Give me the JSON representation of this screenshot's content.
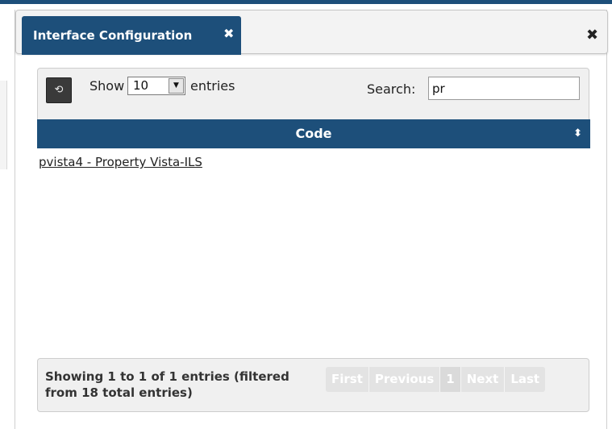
{
  "dialog": {
    "tab_title": "Interface Configuration",
    "tab_close_icon": "close-icon",
    "close_icon": "close-icon"
  },
  "table": {
    "refresh_icon": "refresh-icon",
    "show_label": "Show",
    "page_size": "10",
    "entries_label": "entries",
    "search_label": "Search:",
    "search_value": "pr",
    "columns": [
      {
        "label": "Code",
        "sort_icon": "sort-icon"
      }
    ],
    "rows": [
      {
        "code": "pvista4 - Property Vista-ILS"
      }
    ]
  },
  "footer": {
    "info_line1": "Showing 1 to 1 of 1 entries (filtered",
    "info_line2": "from 18 total entries)",
    "pager": {
      "first": "First",
      "previous": "Previous",
      "current": "1",
      "next": "Next",
      "last": "Last"
    }
  }
}
